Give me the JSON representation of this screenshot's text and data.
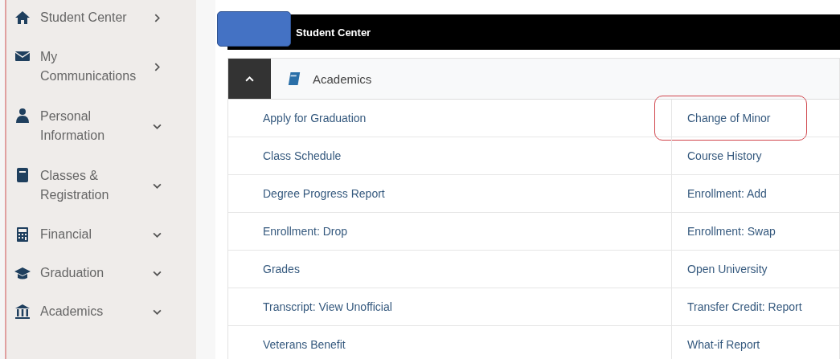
{
  "sidebar": {
    "items": [
      {
        "label": "Student Center",
        "kind": "link"
      },
      {
        "label": "My Communications",
        "kind": "link"
      },
      {
        "label": "Personal Information",
        "kind": "menu"
      },
      {
        "label": "Classes & Registration",
        "kind": "menu"
      },
      {
        "label": "Financial",
        "kind": "menu"
      },
      {
        "label": "Graduation",
        "kind": "menu"
      },
      {
        "label": "Academics",
        "kind": "menu"
      }
    ]
  },
  "header": {
    "title": "Student Center"
  },
  "panel": {
    "title": "Academics",
    "expanded": true,
    "rows": [
      [
        {
          "label": "Apply for Graduation",
          "highlighted": false
        },
        {
          "label": "Change of Minor",
          "highlighted": true
        }
      ],
      [
        {
          "label": "Class Schedule",
          "highlighted": false
        },
        {
          "label": "Course History",
          "highlighted": false
        }
      ],
      [
        {
          "label": "Degree Progress Report",
          "highlighted": false
        },
        {
          "label": "Enrollment: Add",
          "highlighted": false
        }
      ],
      [
        {
          "label": "Enrollment: Drop",
          "highlighted": false
        },
        {
          "label": "Enrollment: Swap",
          "highlighted": false
        }
      ],
      [
        {
          "label": "Grades",
          "highlighted": false
        },
        {
          "label": "Open University",
          "highlighted": false
        }
      ],
      [
        {
          "label": "Transcript: View Unofficial",
          "highlighted": false
        },
        {
          "label": "Transfer Credit: Report",
          "highlighted": false
        }
      ],
      [
        {
          "label": "Veterans Benefit",
          "highlighted": false
        },
        {
          "label": "What-if Report",
          "highlighted": false
        }
      ]
    ]
  }
}
